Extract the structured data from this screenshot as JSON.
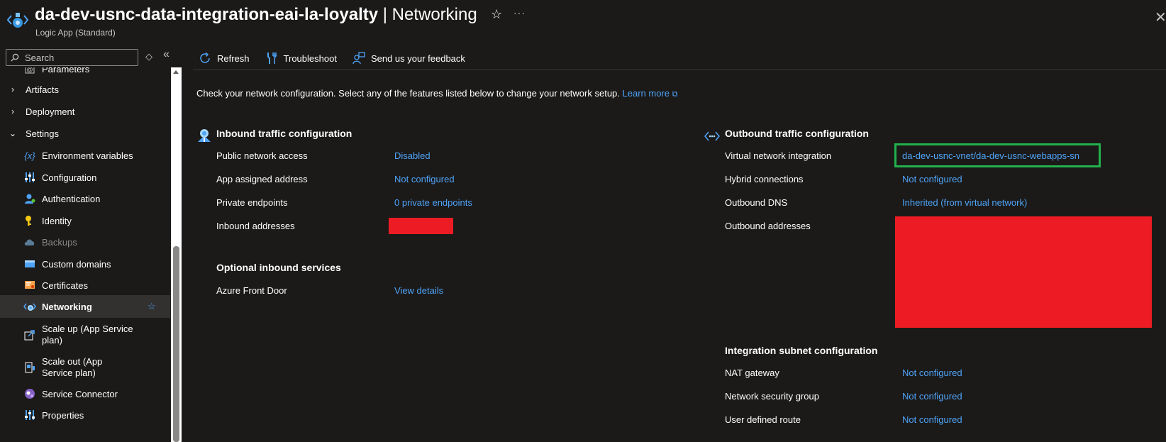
{
  "header": {
    "resource_name": "da-dev-usnc-data-integration-eai-la-loyalty",
    "separator": "|",
    "section": "Networking",
    "subtitle": "Logic App (Standard)",
    "star_icon": "☆",
    "more_icon": "···",
    "close_icon": "✕"
  },
  "sidebar": {
    "search_placeholder": "Search",
    "items": [
      {
        "label": "Parameters"
      },
      {
        "label": "Artifacts"
      },
      {
        "label": "Deployment"
      },
      {
        "label": "Settings"
      },
      {
        "label": "Environment variables"
      },
      {
        "label": "Configuration"
      },
      {
        "label": "Authentication"
      },
      {
        "label": "Identity"
      },
      {
        "label": "Backups"
      },
      {
        "label": "Custom domains"
      },
      {
        "label": "Certificates"
      },
      {
        "label": "Networking"
      },
      {
        "label": "Scale up (App Service plan)"
      },
      {
        "label": "Scale out (App Service plan)"
      },
      {
        "label": "Service Connector"
      },
      {
        "label": "Properties"
      }
    ]
  },
  "toolbar": {
    "refresh": "Refresh",
    "troubleshoot": "Troubleshoot",
    "feedback": "Send us your feedback"
  },
  "intro": {
    "text": "Check your network configuration. Select any of the features listed below to change your network setup.",
    "learn_more": "Learn more"
  },
  "inbound": {
    "title": "Inbound traffic configuration",
    "rows": [
      {
        "label": "Public network access",
        "value": "Disabled"
      },
      {
        "label": "App assigned address",
        "value": "Not configured"
      },
      {
        "label": "Private endpoints",
        "value": "0 private endpoints"
      },
      {
        "label": "Inbound addresses",
        "value": ""
      }
    ]
  },
  "optional_inbound": {
    "title": "Optional inbound services",
    "rows": [
      {
        "label": "Azure Front Door",
        "value": "View details"
      }
    ]
  },
  "outbound": {
    "title": "Outbound traffic configuration",
    "rows": [
      {
        "label": "Virtual network integration",
        "value": "da-dev-usnc-vnet/da-dev-usnc-webapps-sn"
      },
      {
        "label": "Hybrid connections",
        "value": "Not configured"
      },
      {
        "label": "Outbound DNS",
        "value": "Inherited (from virtual network)"
      },
      {
        "label": "Outbound addresses",
        "value": ""
      }
    ]
  },
  "integration_subnet": {
    "title": "Integration subnet configuration",
    "rows": [
      {
        "label": "NAT gateway",
        "value": "Not configured"
      },
      {
        "label": "Network security group",
        "value": "Not configured"
      },
      {
        "label": "User defined route",
        "value": "Not configured"
      }
    ]
  },
  "colors": {
    "link": "#4fa3f7",
    "redaction": "#ed1c24",
    "highlight": "#22b14c",
    "background": "#1b1a19"
  }
}
